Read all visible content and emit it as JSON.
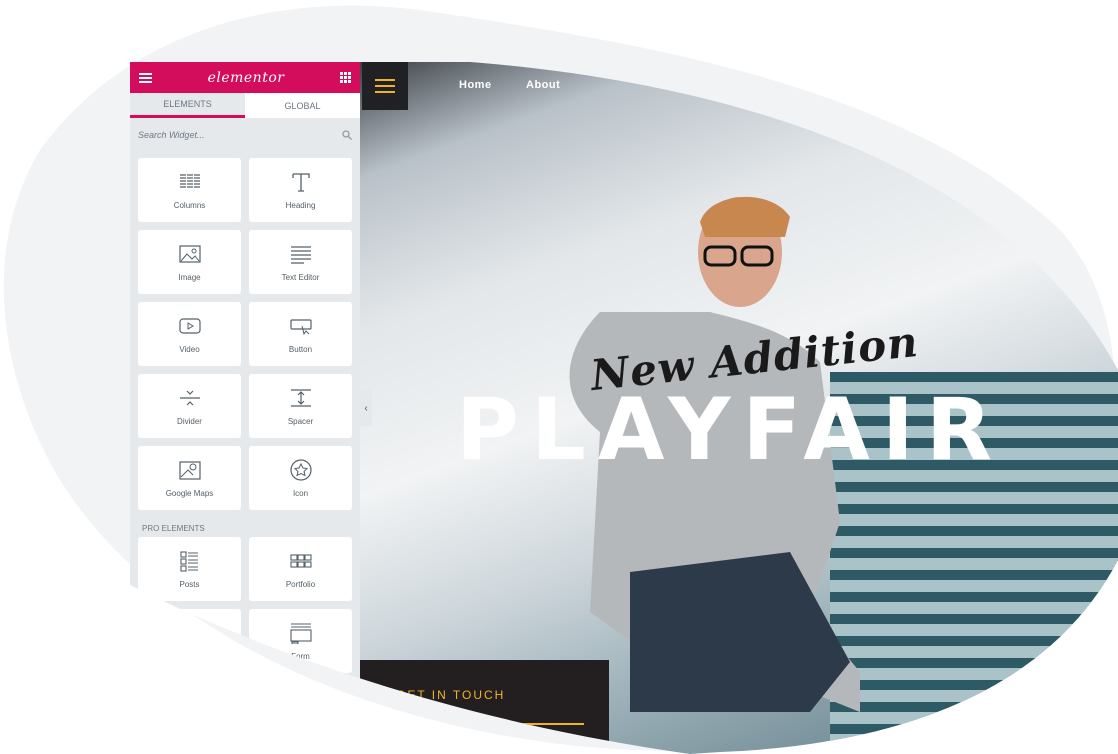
{
  "panel": {
    "logo": "elementor",
    "tabs": [
      "ELEMENTS",
      "GLOBAL"
    ],
    "search_placeholder": "Search Widget...",
    "widgets": [
      {
        "label": "Columns",
        "icon": "columns-icon"
      },
      {
        "label": "Heading",
        "icon": "heading-icon"
      },
      {
        "label": "Image",
        "icon": "image-icon"
      },
      {
        "label": "Text Editor",
        "icon": "text-editor-icon"
      },
      {
        "label": "Video",
        "icon": "video-icon"
      },
      {
        "label": "Button",
        "icon": "button-icon"
      },
      {
        "label": "Divider",
        "icon": "divider-icon"
      },
      {
        "label": "Spacer",
        "icon": "spacer-icon"
      },
      {
        "label": "Google Maps",
        "icon": "map-icon"
      },
      {
        "label": "Icon",
        "icon": "star-icon"
      }
    ],
    "pro_label": "PRO ELEMENTS",
    "pro_widgets": [
      {
        "label": "Posts",
        "icon": "posts-icon"
      },
      {
        "label": "Portfolio",
        "icon": "portfolio-icon"
      },
      {
        "label": "",
        "icon": "slides-icon"
      },
      {
        "label": "Form",
        "icon": "form-icon"
      }
    ]
  },
  "preview": {
    "nav": [
      "Home",
      "About"
    ],
    "script_title": "New Addition",
    "title": "PLAYFAIR",
    "cta": "GET IN TOUCH"
  },
  "colors": {
    "brand": "#d30c5c",
    "accent": "#f0b323",
    "dark": "#231f20"
  }
}
